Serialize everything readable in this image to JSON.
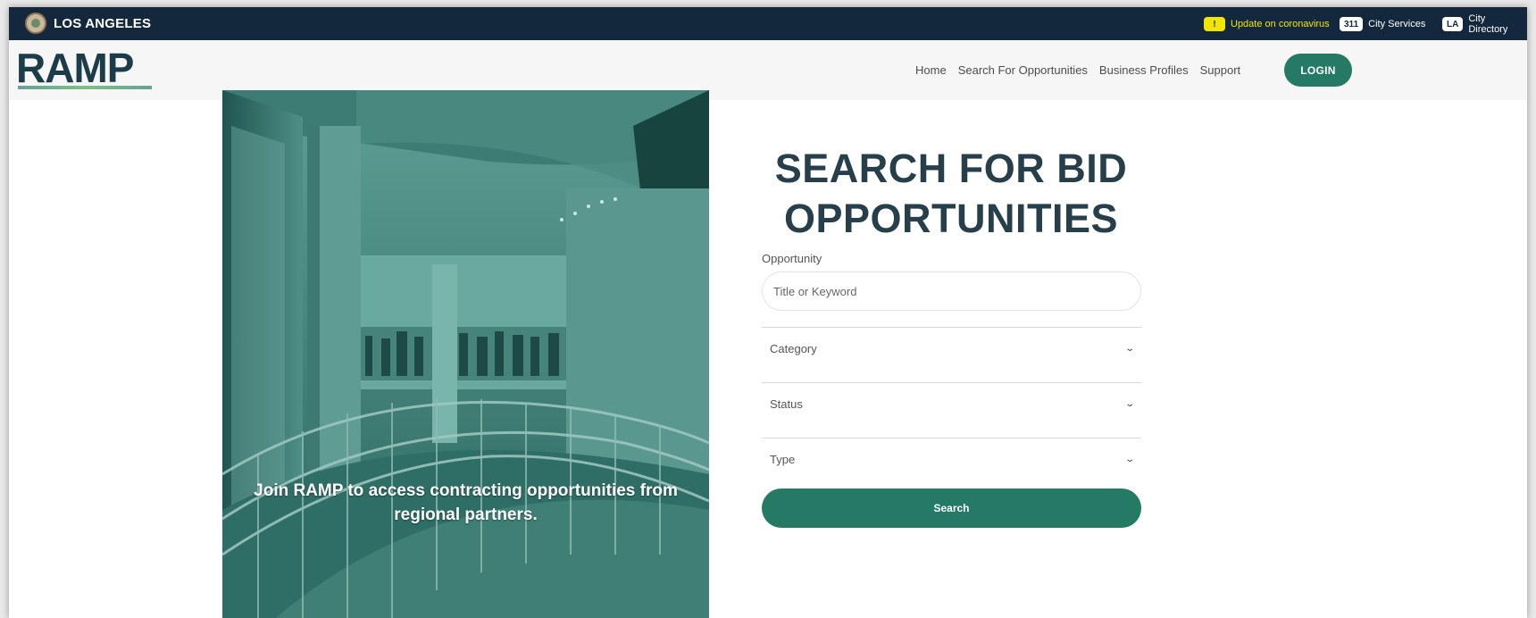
{
  "citybar": {
    "city_name": "LOS ANGELES",
    "covid_badge": "!",
    "covid_link": "Update on coronavirus",
    "services_badge": "311",
    "services_link": "City Services",
    "directory_badge": "LA",
    "directory_link": "City Directory"
  },
  "header": {
    "logo_text": "RAMP",
    "nav": [
      "Home",
      "Search For Opportunities",
      "Business Profiles",
      "Support"
    ],
    "login_label": "LOGIN"
  },
  "hero": {
    "caption_line1": "Join RAMP to access contracting opportunities from",
    "caption_line2": "regional partners."
  },
  "search": {
    "title_line1": "SEARCH FOR BID",
    "title_line2": "OPPORTUNITIES",
    "opportunity_label": "Opportunity",
    "keyword_placeholder": "Title or Keyword",
    "category_label": "Category",
    "status_label": "Status",
    "type_label": "Type",
    "search_label": "Search"
  },
  "colors": {
    "citybar_bg": "#13283d",
    "accent_green": "#257a66",
    "title_color": "#263f4a",
    "covid_yellow": "#f2e600"
  }
}
